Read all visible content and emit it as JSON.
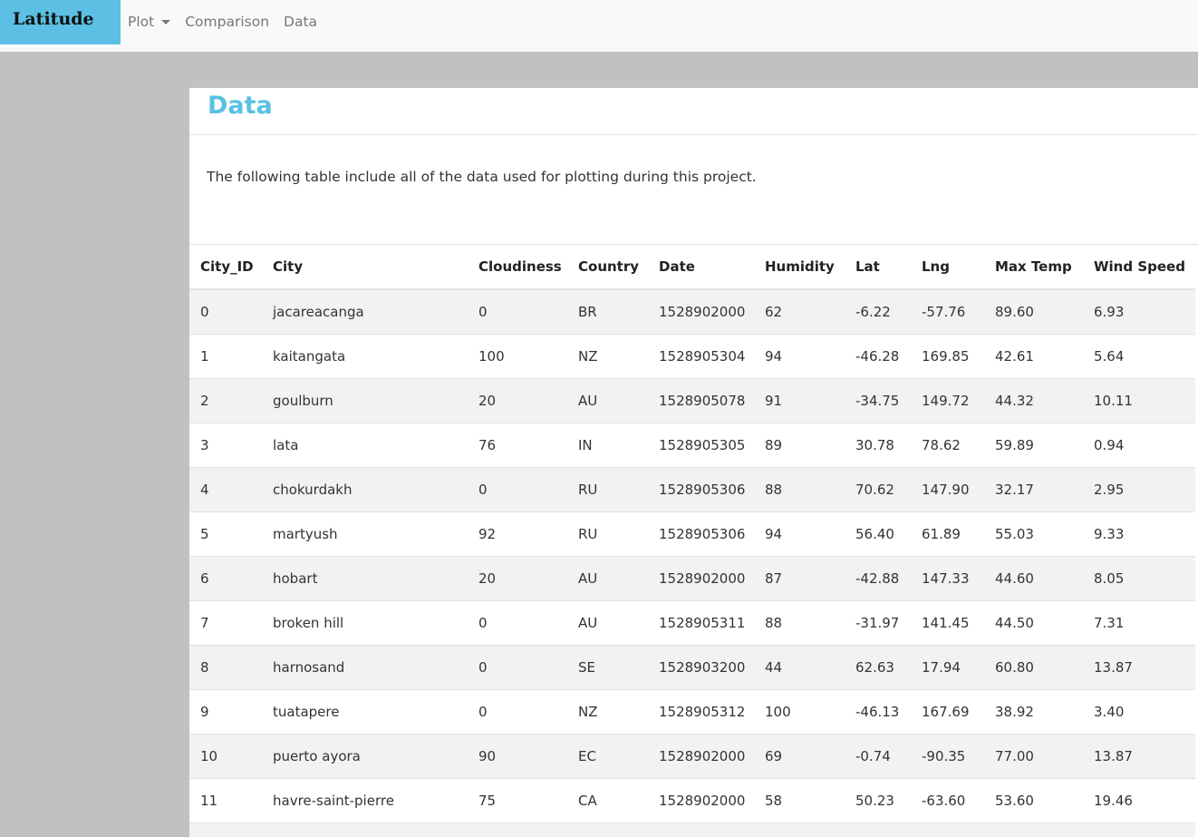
{
  "navbar": {
    "brand": "Latitude",
    "links": [
      {
        "label": "Plot",
        "dropdown": true
      },
      {
        "label": "Comparison"
      },
      {
        "label": "Data"
      }
    ]
  },
  "panel": {
    "title": "Data",
    "intro": "The following table include all of the data used for plotting during this project."
  },
  "table": {
    "columns": [
      "City_ID",
      "City",
      "Cloudiness",
      "Country",
      "Date",
      "Humidity",
      "Lat",
      "Lng",
      "Max Temp",
      "Wind Speed"
    ],
    "rows": [
      [
        "0",
        "jacareacanga",
        "0",
        "BR",
        "1528902000",
        "62",
        "-6.22",
        "-57.76",
        "89.60",
        "6.93"
      ],
      [
        "1",
        "kaitangata",
        "100",
        "NZ",
        "1528905304",
        "94",
        "-46.28",
        "169.85",
        "42.61",
        "5.64"
      ],
      [
        "2",
        "goulburn",
        "20",
        "AU",
        "1528905078",
        "91",
        "-34.75",
        "149.72",
        "44.32",
        "10.11"
      ],
      [
        "3",
        "lata",
        "76",
        "IN",
        "1528905305",
        "89",
        "30.78",
        "78.62",
        "59.89",
        "0.94"
      ],
      [
        "4",
        "chokurdakh",
        "0",
        "RU",
        "1528905306",
        "88",
        "70.62",
        "147.90",
        "32.17",
        "2.95"
      ],
      [
        "5",
        "martyush",
        "92",
        "RU",
        "1528905306",
        "94",
        "56.40",
        "61.89",
        "55.03",
        "9.33"
      ],
      [
        "6",
        "hobart",
        "20",
        "AU",
        "1528902000",
        "87",
        "-42.88",
        "147.33",
        "44.60",
        "8.05"
      ],
      [
        "7",
        "broken hill",
        "0",
        "AU",
        "1528905311",
        "88",
        "-31.97",
        "141.45",
        "44.50",
        "7.31"
      ],
      [
        "8",
        "harnosand",
        "0",
        "SE",
        "1528903200",
        "44",
        "62.63",
        "17.94",
        "60.80",
        "13.87"
      ],
      [
        "9",
        "tuatapere",
        "0",
        "NZ",
        "1528905312",
        "100",
        "-46.13",
        "167.69",
        "38.92",
        "3.40"
      ],
      [
        "10",
        "puerto ayora",
        "90",
        "EC",
        "1528902000",
        "69",
        "-0.74",
        "-90.35",
        "77.00",
        "13.87"
      ],
      [
        "11",
        "havre-saint-pierre",
        "75",
        "CA",
        "1528902000",
        "58",
        "50.23",
        "-63.60",
        "53.60",
        "19.46"
      ],
      [
        "",
        "",
        "",
        "",
        "",
        "",
        "",
        "",
        "",
        ""
      ]
    ]
  }
}
